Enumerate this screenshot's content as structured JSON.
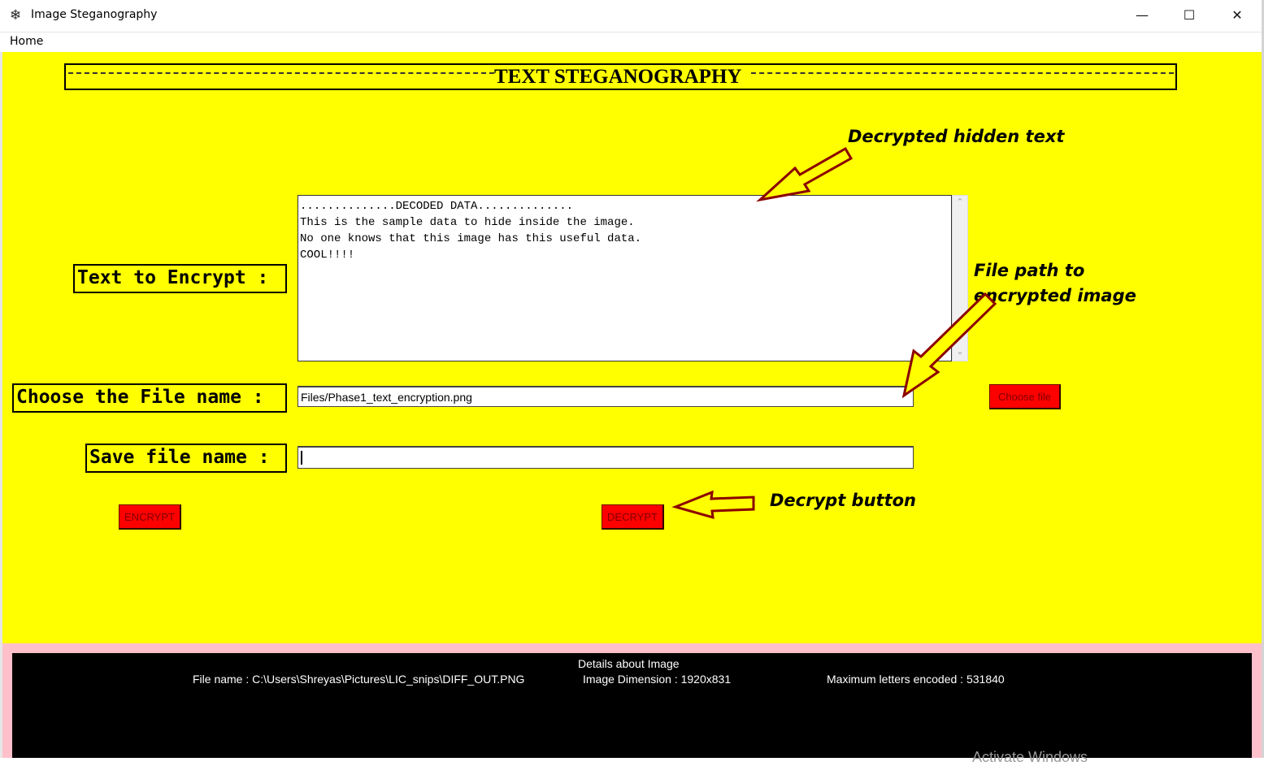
{
  "window": {
    "title": "Image Steganography",
    "icon": "feather-icon",
    "controls": {
      "minimize": "—",
      "maximize": "☐",
      "close": "✕"
    }
  },
  "menu": {
    "home_label": "Home"
  },
  "header": {
    "title": "TEXT STEGANOGRAPHY"
  },
  "form": {
    "text_label": "Text to Encrypt :",
    "file_label": "Choose the File name :",
    "save_label": "Save file name :",
    "textarea_lines": [
      "..............DECODED DATA..............",
      "This is the sample data to hide inside the image.",
      "No one knows that this image has this useful data.",
      "COOL!!!!"
    ],
    "file_value": "Files/Phase1_text_encryption.png",
    "save_value": "",
    "choose_file_button": "Choose file",
    "encrypt_button": "ENCRYPT",
    "decrypt_button": "DECRYPT"
  },
  "annotations": {
    "hidden_text": "Decrypted hidden text",
    "file_path_line1": "File path to",
    "file_path_line2": "encrypted image",
    "decrypt_button": "Decrypt button"
  },
  "details": {
    "title": "Details about Image",
    "file_name": "File name : C:\\Users\\Shreyas\\Pictures\\LIC_snips\\DIFF_OUT.PNG",
    "dimension": "Image Dimension : 1920x831",
    "max_letters": "Maximum letters encoded : 531840"
  },
  "watermark": "Activate Windows",
  "colors": {
    "background": "#ffff00",
    "button": "#ff0000",
    "button_text": "#800000",
    "arrow": "#8b0000",
    "details_border": "#ffc0cb",
    "details_bg": "#000000"
  }
}
